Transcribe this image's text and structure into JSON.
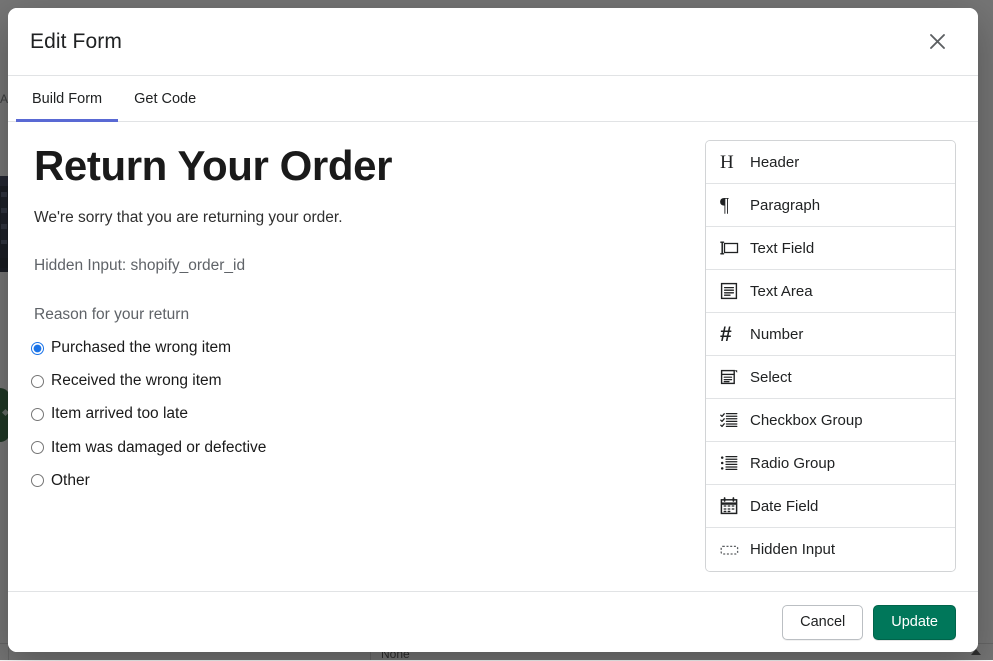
{
  "background": {
    "sidebar_letter": "A",
    "bottom_row_label": "None"
  },
  "modal": {
    "title": "Edit Form",
    "close_icon": "close-icon",
    "tabs": [
      {
        "label": "Build Form",
        "active": true
      },
      {
        "label": "Get Code",
        "active": false
      }
    ],
    "accent_tab_color": "#5969d4"
  },
  "form_preview": {
    "heading": "Return Your Order",
    "paragraph": "We're sorry that you are returning your order.",
    "hidden_input_label": "Hidden Input: shopify_order_id",
    "radio_group": {
      "label": "Reason for your return",
      "selected_index": 0,
      "options": [
        "Purchased the wrong item",
        "Received the wrong item",
        "Item arrived too late",
        "Item was damaged or defective",
        "Other"
      ]
    },
    "radio_selected_color": "#1a73e8"
  },
  "palette": {
    "items": [
      {
        "label": "Header",
        "icon": "heading-h-icon"
      },
      {
        "label": "Paragraph",
        "icon": "pilcrow-icon"
      },
      {
        "label": "Text Field",
        "icon": "text-field-icon"
      },
      {
        "label": "Text Area",
        "icon": "text-area-icon"
      },
      {
        "label": "Number",
        "icon": "hash-icon"
      },
      {
        "label": "Select",
        "icon": "select-dropdown-icon"
      },
      {
        "label": "Checkbox Group",
        "icon": "checkbox-list-icon"
      },
      {
        "label": "Radio Group",
        "icon": "radio-list-icon"
      },
      {
        "label": "Date Field",
        "icon": "calendar-icon"
      },
      {
        "label": "Hidden Input",
        "icon": "hidden-input-icon"
      }
    ]
  },
  "footer": {
    "cancel_label": "Cancel",
    "update_label": "Update",
    "primary_color": "#00775a"
  }
}
